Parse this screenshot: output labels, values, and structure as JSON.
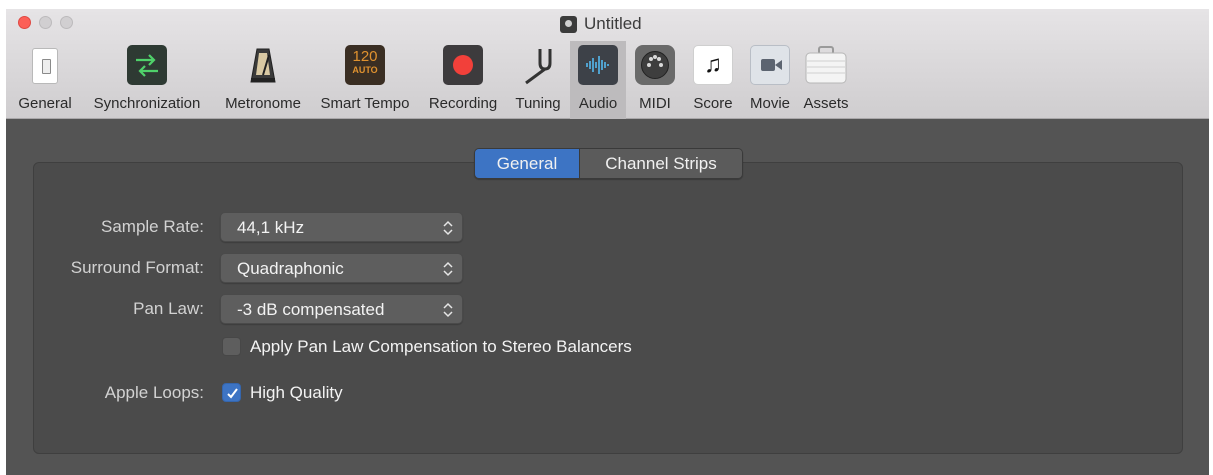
{
  "window": {
    "title": "Untitled"
  },
  "toolbar": {
    "items": [
      {
        "label": "General",
        "icon": "general-icon"
      },
      {
        "label": "Synchronization",
        "icon": "sync-icon"
      },
      {
        "label": "Metronome",
        "icon": "metronome-icon"
      },
      {
        "label": "Smart Tempo",
        "icon": "smart-tempo-icon",
        "badge_top": "120",
        "badge_bottom": "AUTO"
      },
      {
        "label": "Recording",
        "icon": "record-icon"
      },
      {
        "label": "Tuning",
        "icon": "tuning-fork-icon"
      },
      {
        "label": "Audio",
        "icon": "audio-waveform-icon",
        "active": true
      },
      {
        "label": "MIDI",
        "icon": "midi-connector-icon"
      },
      {
        "label": "Score",
        "icon": "music-note-icon",
        "glyph": "♫"
      },
      {
        "label": "Movie",
        "icon": "movie-camera-icon"
      },
      {
        "label": "Assets",
        "icon": "briefcase-icon"
      }
    ]
  },
  "tabs": [
    {
      "label": "General",
      "selected": true
    },
    {
      "label": "Channel Strips",
      "selected": false
    }
  ],
  "settings": {
    "sample_rate": {
      "label": "Sample Rate:",
      "value": "44,1 kHz"
    },
    "surround_format": {
      "label": "Surround Format:",
      "value": "Quadraphonic"
    },
    "pan_law": {
      "label": "Pan Law:",
      "value": "-3 dB compensated"
    },
    "pan_law_compensation": {
      "label": "Apply Pan Law Compensation to Stereo Balancers",
      "checked": false
    },
    "apple_loops": {
      "label": "Apple Loops:",
      "option_label": "High Quality",
      "checked": true
    }
  },
  "colors": {
    "accent": "#3d74c4",
    "record_red": "#f2403a",
    "close_button": "#fc5f57",
    "panel_bg": "#545454"
  }
}
